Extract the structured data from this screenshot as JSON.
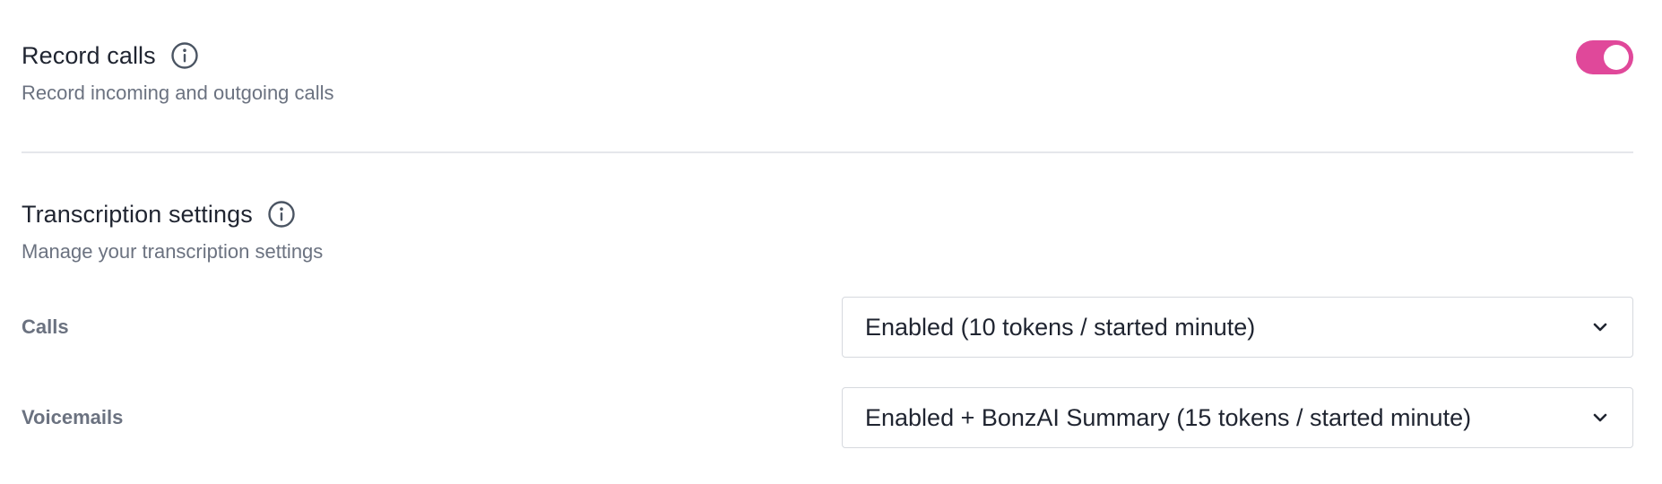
{
  "record_calls": {
    "title": "Record calls",
    "description": "Record incoming and outgoing calls",
    "toggle_on": true,
    "toggle_color": "#e0489a"
  },
  "transcription": {
    "title": "Transcription settings",
    "description": "Manage your transcription settings",
    "rows": [
      {
        "label": "Calls",
        "value": "Enabled (10 tokens / started minute)"
      },
      {
        "label": "Voicemails",
        "value": "Enabled + BonzAI Summary (15 tokens / started minute)"
      }
    ]
  },
  "icons": {
    "info": "info-icon",
    "dropdown": "chevron-down-icon"
  }
}
